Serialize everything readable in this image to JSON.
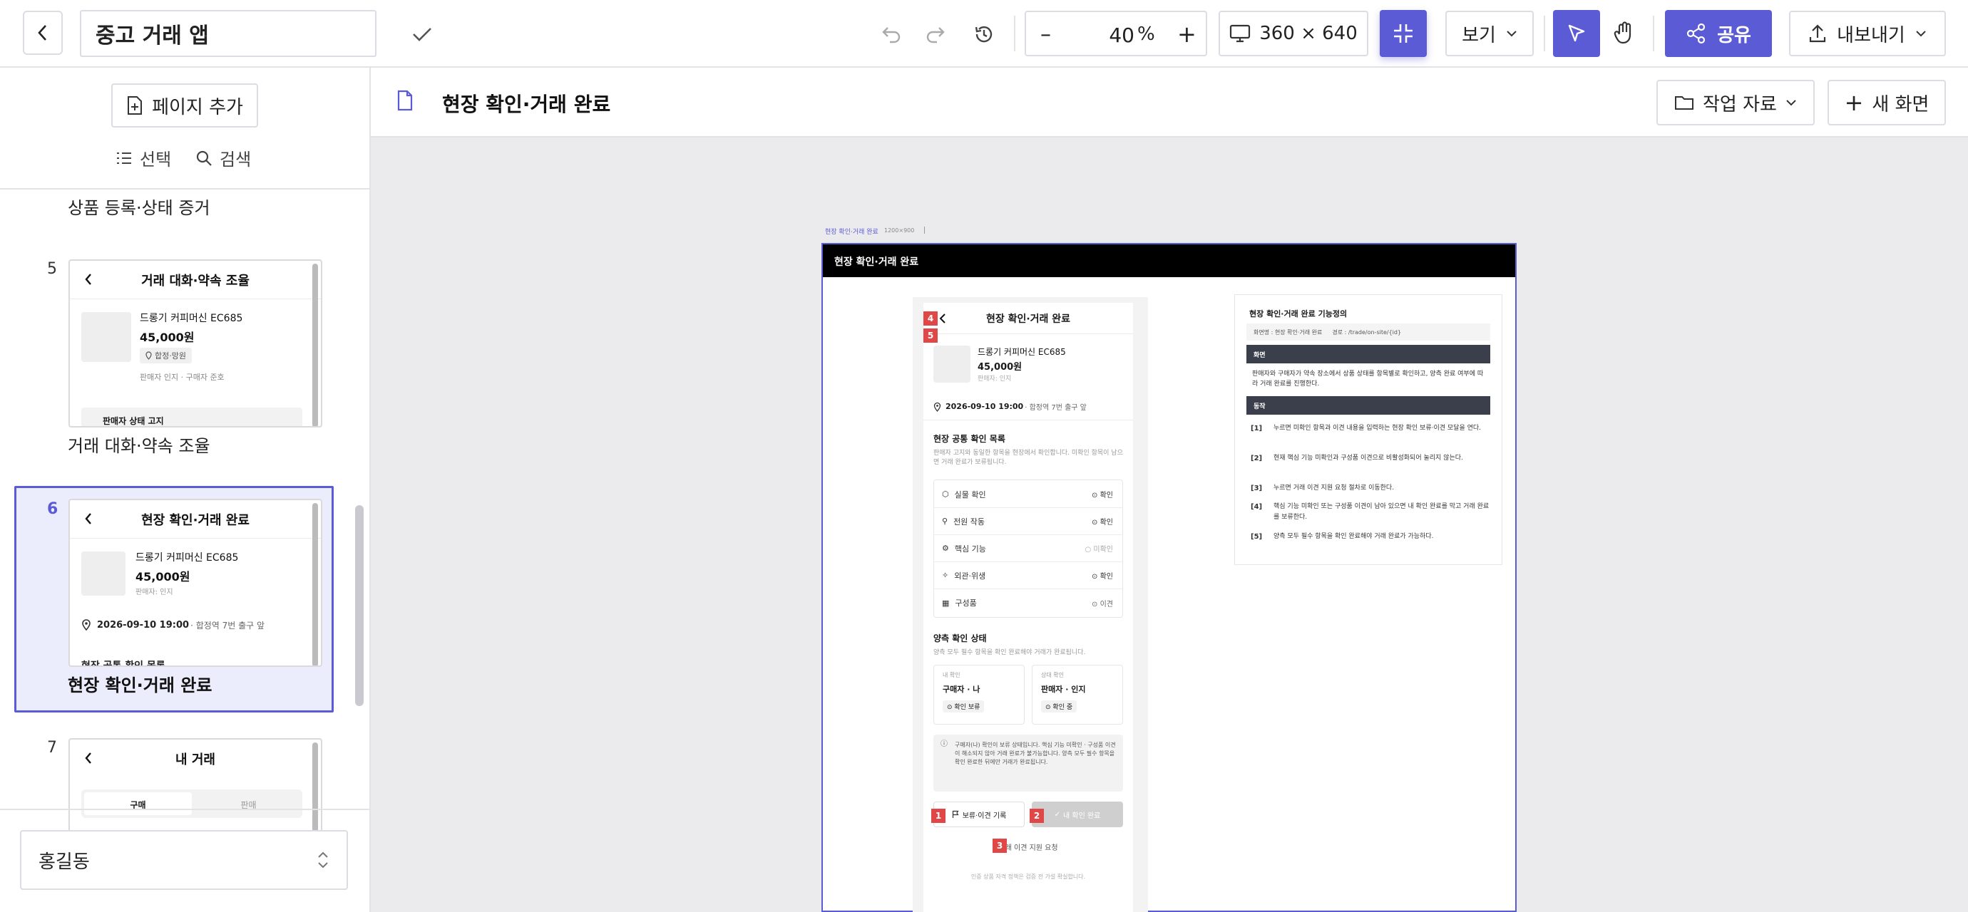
{
  "toolbar": {
    "project_title": "중고 거래 앱",
    "zoom_value": "40",
    "zoom_unit": "%",
    "device_size": "360 × 640",
    "view_label": "보기",
    "share_label": "공유",
    "export_label": "내보내기"
  },
  "sidebar": {
    "add_page_label": "페이지 추가",
    "select_label": "선택",
    "search_label": "검색",
    "top_caption": "상품 등록·상태 증거",
    "pages": [
      {
        "number": "5",
        "title": "거래 대화·약속 조율",
        "caption": "거래 대화·약속 조율",
        "product": "드롱기 커피머신 EC685",
        "price": "45,000원",
        "tag": "합정·망원",
        "meta": "판매자 인지 · 구매자 준호",
        "footer": "판매자 상태 고지"
      },
      {
        "number": "6",
        "title": "현장 확인·거래 완료",
        "caption": "현장 확인·거래 완료",
        "product": "드롱기 커피머신 EC685",
        "price": "45,000원",
        "meta": "판매자: 인지",
        "datetime": "2026-09-10 19:00",
        "place": " · 합정역 7번 출구 앞",
        "footer": "현장 공통 확인 목록"
      },
      {
        "number": "7",
        "title": "내 거래",
        "tab_buy": "구매",
        "tab_sell": "판매"
      }
    ],
    "user_name": "홍길동"
  },
  "canvas_header": {
    "page_title": "현장 확인·거래 완료",
    "assets_label": "작업 자료",
    "new_screen_label": "새 화면"
  },
  "frame": {
    "label": "현장 확인·거래 완료",
    "size_label": "1200×900",
    "header_title": "현장 확인·거래 완료"
  },
  "phone": {
    "title": "현장 확인·거래 완료",
    "product_name": "드롱기 커피머신 EC685",
    "price": "45,000원",
    "seller": "판매자: 인지",
    "datetime": "2026-09-10 19:00",
    "place": " · 합정역 7번 출구 앞",
    "common_title": "현장 공통 확인 목록",
    "common_desc": "판매자 고지와 동일한 항목을 현장에서 확인합니다. 미확인 항목이 남으면 거래 완료가 보류됩니다.",
    "check_items": [
      {
        "label": "실물 확인",
        "status": "확인"
      },
      {
        "label": "전원 작동",
        "status": "확인"
      },
      {
        "label": "핵심 기능",
        "status": "미확인"
      },
      {
        "label": "외관·위생",
        "status": "확인"
      },
      {
        "label": "구성품",
        "status": "이견"
      }
    ],
    "both_title": "양측 확인 상태",
    "both_desc": "양측 모두 필수 항목을 확인 완료해야 거래가 완료됩니다.",
    "mine": {
      "caption": "내 확인",
      "who": "구매자 · 나",
      "status": "확인 보류"
    },
    "other": {
      "caption": "상대 확인",
      "who": "판매자 · 인지",
      "status": "확인 중"
    },
    "notice": "구매자(나) 확인이 보류 상태입니다. 핵심 기능 미확인 · 구성품 이견이 해소되지 않아 거래 완료가 불가능합니다. 양측 모두 필수 항목을 확인 완료한 뒤에만 거래가 완료됩니다.",
    "hold_button": "보류·이견 기록",
    "complete_button": "내 확인 완료",
    "support_link": "거래 이견 지원 요청",
    "footer_note": "인증 상품 자격 정책은 검증 전 가설 확실합니다."
  },
  "badges": {
    "b1": "1",
    "b2": "2",
    "b3": "3",
    "b4": "4",
    "b5": "5"
  },
  "spec": {
    "title": "현장 확인·거래 완료 기능정의",
    "screen_name": "화면명 : 현장 확인·거래 완료",
    "path": "경로 : /trade/on-site/{id}",
    "section_screen": "화면",
    "screen_desc": "판매자와 구매자가 약속 장소에서 상품 상태를 항목별로 확인하고, 양측 완료 여부에 따라 거래 완료를 진행한다.",
    "section_action": "동작",
    "rows": [
      {
        "key": "[1]",
        "text": "누르면 미확인 항목과 이견 내용을 입력하는 현장 확인 보류·이견 모달을 연다."
      },
      {
        "key": "[2]",
        "text": "현재 핵심 기능 미확인과 구성품 이견으로 비활성화되어 눌리지 않는다."
      },
      {
        "key": "[3]",
        "text": "누르면 거래 이견 지원 요청 절차로 이동한다."
      },
      {
        "key": "[4]",
        "text": "핵심 기능 미확인 또는 구성품 이견이 남아 있으면 내 확인 완료를 막고 거래 완료를 보류한다."
      },
      {
        "key": "[5]",
        "text": "양측 모두 필수 항목을 확인 완료해야 거래 완료가 가능하다."
      }
    ]
  },
  "colors": {
    "accent": "#5b5bd6",
    "danger": "#e04848",
    "dark": "#111111"
  }
}
